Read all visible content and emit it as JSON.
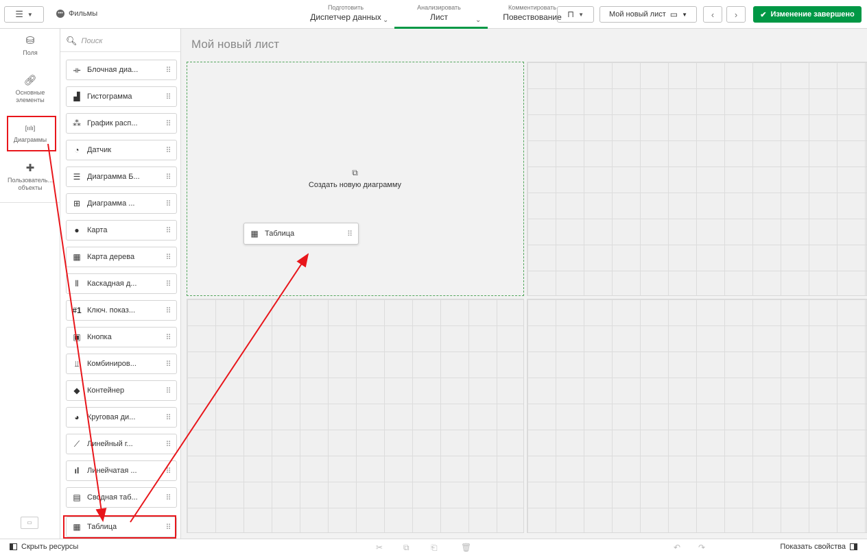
{
  "app": {
    "title": "Фильмы",
    "menu_icon": "hamburger-icon",
    "app_icon": "app-icon"
  },
  "tabs": [
    {
      "small": "Подготовить",
      "label": "Диспетчер данных"
    },
    {
      "small": "Анализировать",
      "label": "Лист"
    },
    {
      "small": "Комментировать",
      "label": "Повествование"
    }
  ],
  "toolbar": {
    "sheet_name": "Мой новый лист",
    "done_label": "Изменение завершено"
  },
  "rail": {
    "items": [
      {
        "label": "Поля",
        "icon": "database-icon"
      },
      {
        "label": "Основные элементы",
        "icon": "link-icon"
      },
      {
        "label": "Диаграммы",
        "icon": "bar-chart-icon"
      },
      {
        "label": "Пользователь... объекты",
        "icon": "puzzle-icon"
      }
    ]
  },
  "panel": {
    "search_placeholder": "Поиск",
    "assets": [
      {
        "label": "Блочная диа...",
        "icon": "boxplot-icon"
      },
      {
        "label": "Гистограмма",
        "icon": "histogram-icon"
      },
      {
        "label": "График расп...",
        "icon": "distribution-icon"
      },
      {
        "label": "Датчик",
        "icon": "gauge-icon"
      },
      {
        "label": "Диаграмма Б...",
        "icon": "bullet-icon"
      },
      {
        "label": "Диаграмма ...",
        "icon": "mekko-icon"
      },
      {
        "label": "Карта",
        "icon": "globe-icon"
      },
      {
        "label": "Карта дерева",
        "icon": "treemap-icon"
      },
      {
        "label": "Каскадная д...",
        "icon": "waterfall-icon"
      },
      {
        "label": "Ключ. показ...",
        "icon": "kpi-icon"
      },
      {
        "label": "Кнопка",
        "icon": "button-icon"
      },
      {
        "label": "Комбиниров...",
        "icon": "combo-icon"
      },
      {
        "label": "Контейнер",
        "icon": "container-icon"
      },
      {
        "label": "Круговая ди...",
        "icon": "pie-icon"
      },
      {
        "label": "Линейный г...",
        "icon": "line-chart-icon"
      },
      {
        "label": "Линейчатая ...",
        "icon": "bar-icon"
      },
      {
        "label": "Сводная таб...",
        "icon": "pivot-icon"
      },
      {
        "label": "Таблица",
        "icon": "table-icon"
      }
    ]
  },
  "canvas": {
    "sheet_title": "Мой новый лист",
    "create_label": "Создать новую диаграмму",
    "drag_label": "Таблица"
  },
  "bottom": {
    "hide_resources": "Скрыть ресурсы",
    "show_properties": "Показать свойства"
  }
}
